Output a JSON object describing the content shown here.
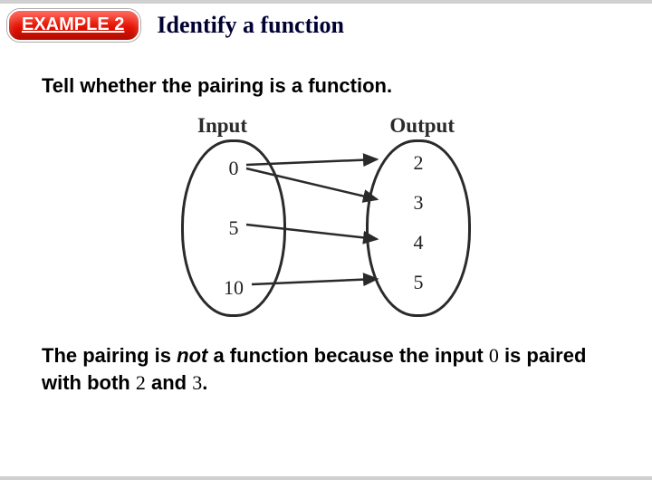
{
  "header": {
    "badge": "EXAMPLE 2",
    "title": "Identify a function"
  },
  "instruction": "Tell whether the pairing is a function.",
  "diagram": {
    "input_label": "Input",
    "output_label": "Output",
    "inputs": [
      "0",
      "5",
      "10"
    ],
    "outputs": [
      "2",
      "3",
      "4",
      "5"
    ],
    "mappings": [
      {
        "from": 0,
        "to": 0
      },
      {
        "from": 0,
        "to": 1
      },
      {
        "from": 1,
        "to": 2
      },
      {
        "from": 2,
        "to": 3
      }
    ]
  },
  "conclusion": {
    "part1": "The pairing is ",
    "emph": "not",
    "part2": " a function because the input ",
    "num1": "0",
    "part3": " is paired with both ",
    "num2": "2",
    "part4": " and ",
    "num3": "3",
    "part5": "."
  }
}
